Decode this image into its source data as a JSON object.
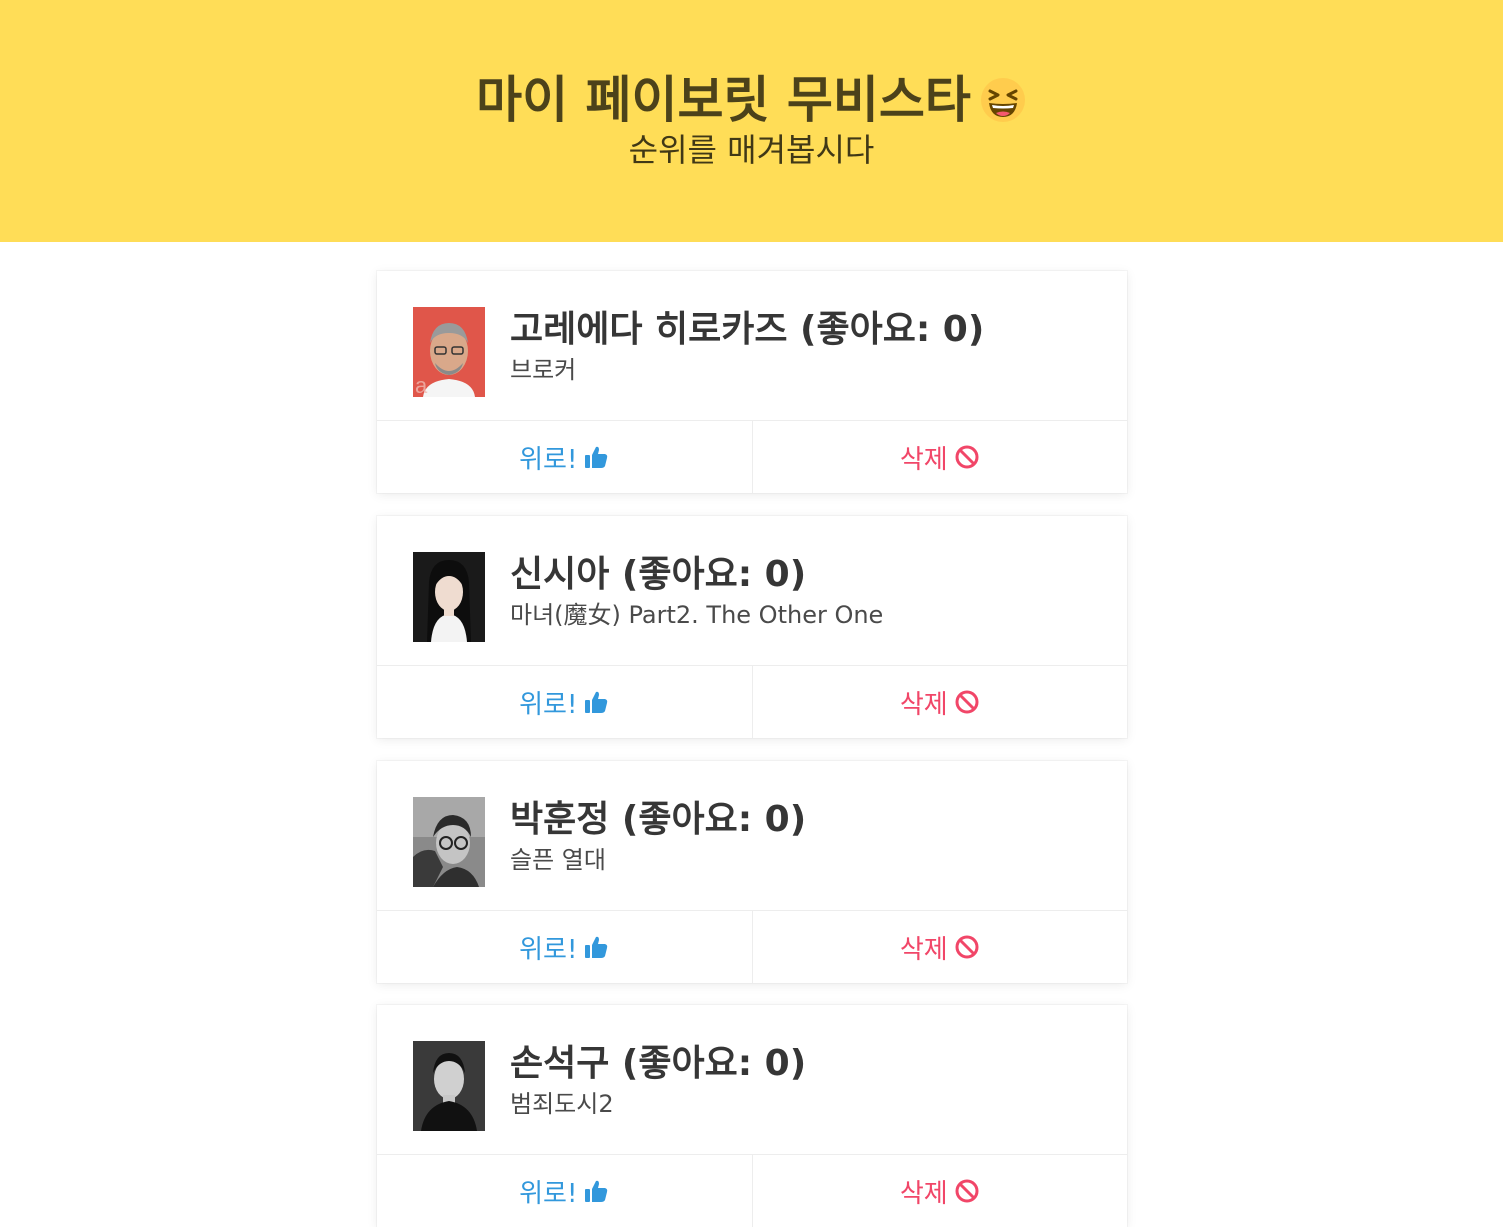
{
  "hero": {
    "title": "마이 페이보릿 무비스타",
    "emoji": "grinning-squinting-face-icon",
    "subtitle": "순위를 매겨봅시다"
  },
  "cards": [
    {
      "name": "고레에다 히로카즈",
      "likes_text": "(좋아요: 0)",
      "movie": "브로커",
      "up_label": "위로!",
      "delete_label": "삭제",
      "photo_bg": "#e0564a"
    },
    {
      "name": "신시아",
      "likes_text": "(좋아요: 0)",
      "movie": "마녀(魔女) Part2. The Other One",
      "up_label": "위로!",
      "delete_label": "삭제",
      "photo_bg": "#1a1a1a"
    },
    {
      "name": "박훈정",
      "likes_text": "(좋아요: 0)",
      "movie": "슬픈 열대",
      "up_label": "위로!",
      "delete_label": "삭제",
      "photo_bg": "#6b6b6b"
    },
    {
      "name": "손석구",
      "likes_text": "(좋아요: 0)",
      "movie": "범죄도시2",
      "up_label": "위로!",
      "delete_label": "삭제",
      "photo_bg": "#2a2a2a"
    }
  ],
  "colors": {
    "hero_bg": "#ffdd57",
    "up": "#3298dc",
    "delete": "#f14668"
  }
}
